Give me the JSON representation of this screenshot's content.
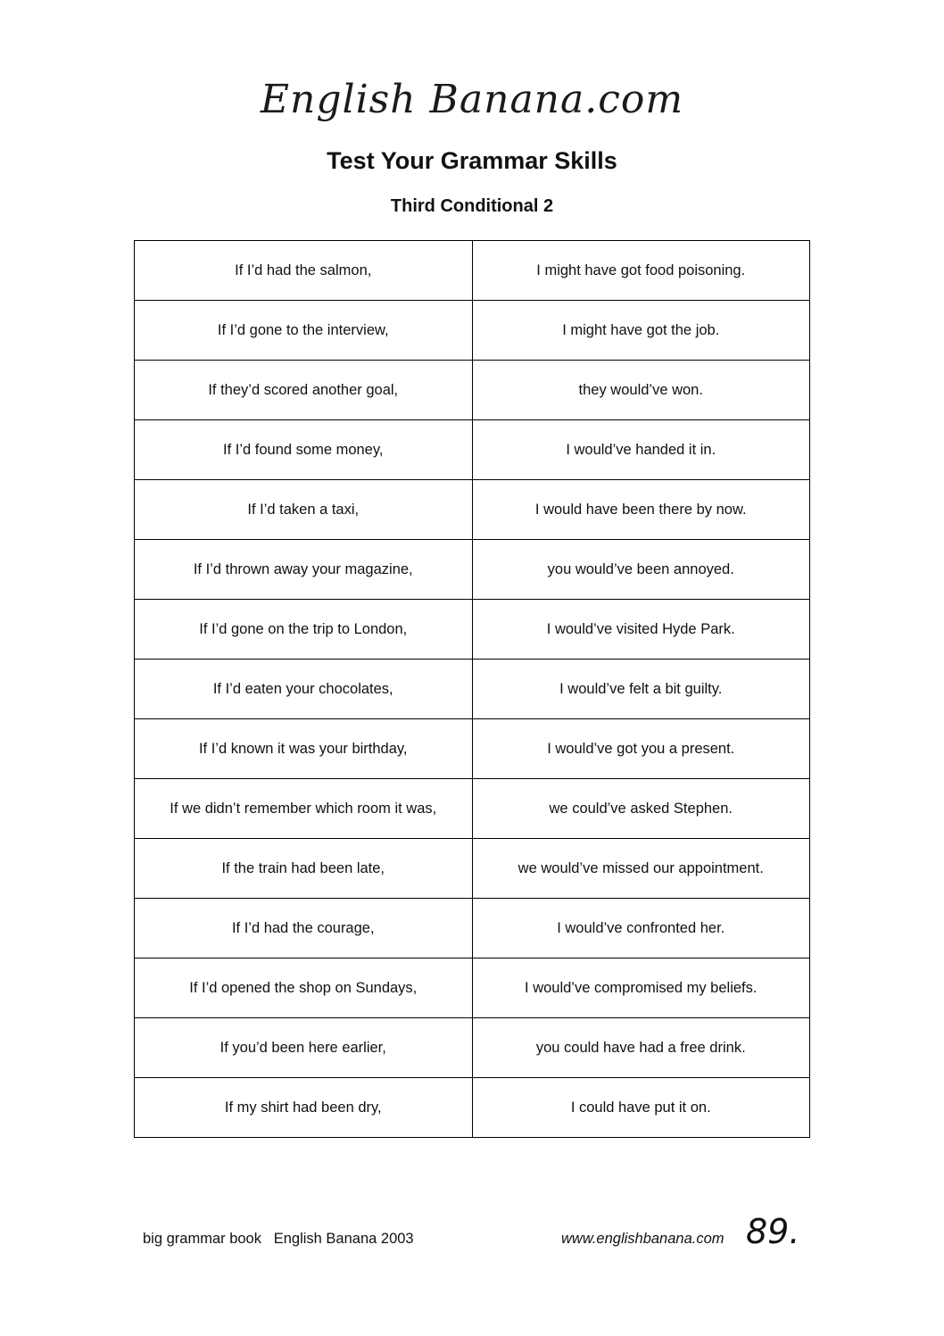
{
  "header": {
    "logo": "English Banana.com",
    "title": "Test Your Grammar Skills",
    "subtitle": "Third Conditional 2"
  },
  "rows": [
    {
      "left": "If I’d had the salmon,",
      "right": "I might have got food poisoning."
    },
    {
      "left": "If I’d gone to the interview,",
      "right": "I might have got the job."
    },
    {
      "left": "If they’d scored another goal,",
      "right": "they would’ve won."
    },
    {
      "left": "If I’d found some money,",
      "right": "I would’ve handed it in."
    },
    {
      "left": "If I’d taken a taxi,",
      "right": "I would have been there by now."
    },
    {
      "left": "If I’d thrown away your magazine,",
      "right": "you would’ve been annoyed."
    },
    {
      "left": "If I’d gone on the trip to London,",
      "right": "I would’ve visited Hyde Park."
    },
    {
      "left": "If I’d eaten your chocolates,",
      "right": "I would’ve felt a bit guilty."
    },
    {
      "left": "If I’d known it was your birthday,",
      "right": "I would’ve got you a present."
    },
    {
      "left": "If we didn’t remember which room it was,",
      "right": "we could’ve asked Stephen."
    },
    {
      "left": "If the train had been late,",
      "right": "we would’ve missed our appointment."
    },
    {
      "left": "If I’d had the courage,",
      "right": "I would’ve confronted her."
    },
    {
      "left": "If I’d opened the shop on Sundays,",
      "right": "I would’ve compromised my beliefs."
    },
    {
      "left": "If you’d been here earlier,",
      "right": "you could have had a free drink."
    },
    {
      "left": "If my shirt had been dry,",
      "right": "I could have put it on."
    }
  ],
  "footer": {
    "left": "big grammar book   English Banana 2003",
    "url": "www.englishbanana.com",
    "page_number": "89."
  }
}
